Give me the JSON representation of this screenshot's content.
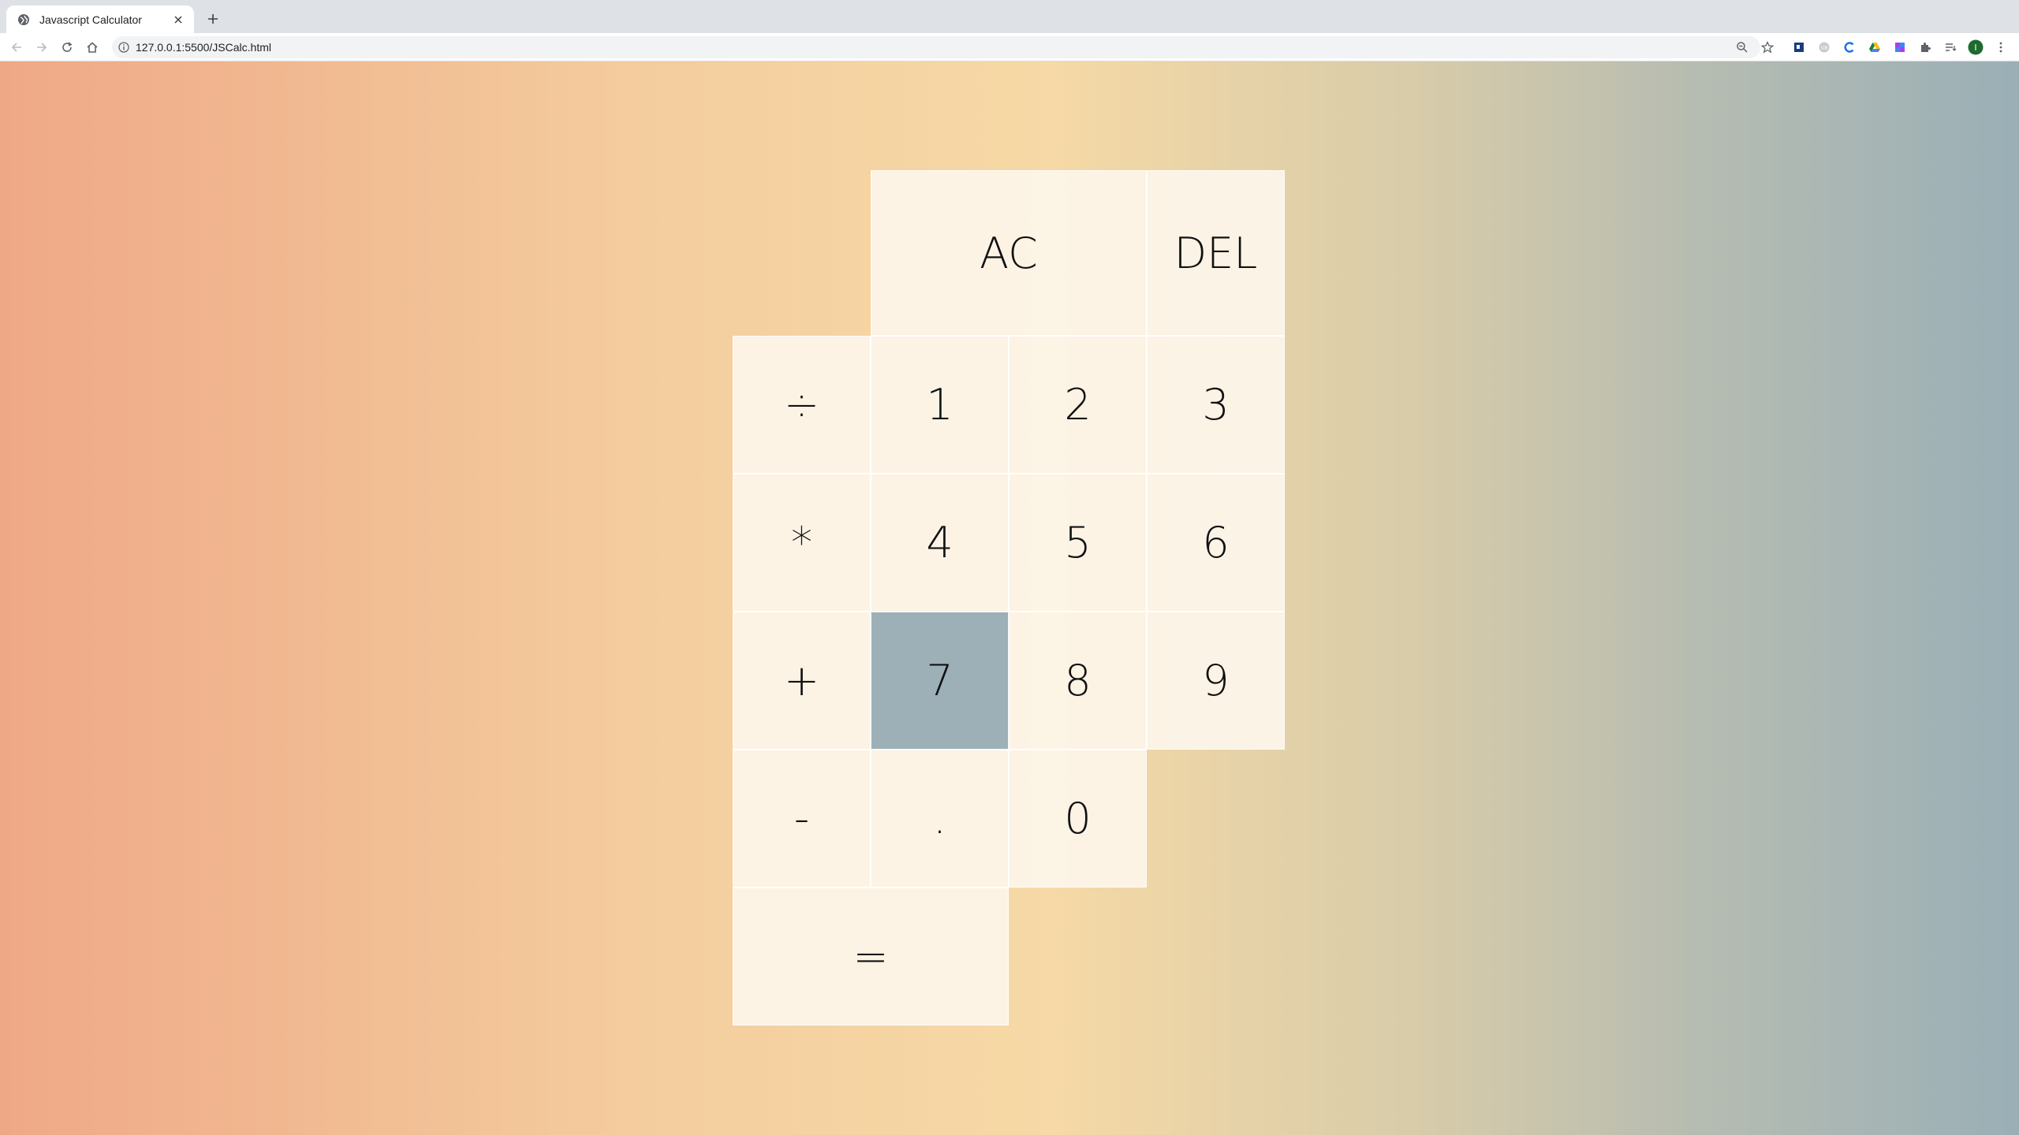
{
  "browser": {
    "tab_title": "Javascript Calculator",
    "url": "127.0.0.1:5500/JSCalc.html"
  },
  "calculator": {
    "keys": {
      "ac": "AC",
      "del": "DEL",
      "divide": "÷",
      "one": "1",
      "two": "2",
      "three": "3",
      "multiply": "*",
      "four": "4",
      "five": "5",
      "six": "6",
      "plus": "+",
      "seven": "7",
      "eight": "8",
      "nine": "9",
      "minus": "-",
      "dot": ".",
      "zero": "0",
      "equals": "="
    },
    "highlighted_key": "7",
    "colors": {
      "key_background": "#fdf6ec",
      "key_highlight": "#9db0b8",
      "gradient_left": "#efa886",
      "gradient_mid": "#f6d9a6",
      "gradient_right": "#9aafb6"
    }
  }
}
